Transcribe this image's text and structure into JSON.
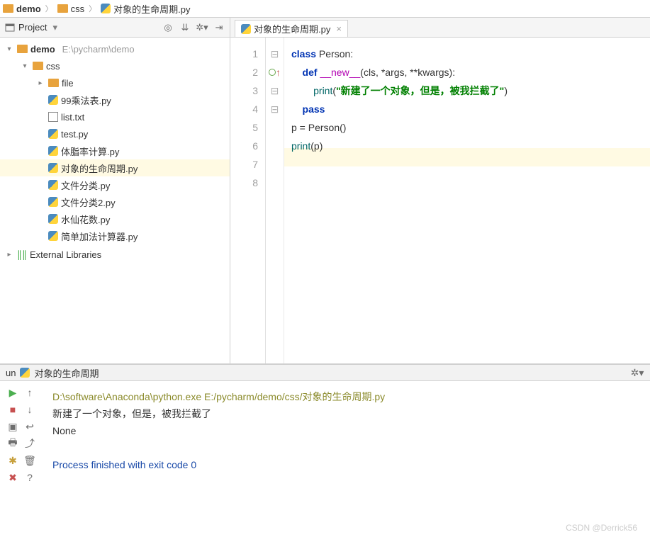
{
  "breadcrumbs": [
    {
      "icon": "folder",
      "label": "demo"
    },
    {
      "icon": "folder",
      "label": "css"
    },
    {
      "icon": "py",
      "label": "对象的生命周期.py"
    }
  ],
  "project": {
    "title": "Project",
    "view_mode": "▾",
    "root_label": "demo",
    "root_path": "E:\\pycharm\\demo",
    "folder": "css",
    "subfolder": "file",
    "files": [
      {
        "icon": "py",
        "name": "99乘法表.py",
        "sel": false
      },
      {
        "icon": "txt",
        "name": "list.txt",
        "sel": false
      },
      {
        "icon": "py",
        "name": "test.py",
        "sel": false
      },
      {
        "icon": "py",
        "name": "体脂率计算.py",
        "sel": false
      },
      {
        "icon": "py",
        "name": "对象的生命周期.py",
        "sel": true
      },
      {
        "icon": "py",
        "name": "文件分类.py",
        "sel": false
      },
      {
        "icon": "py",
        "name": "文件分类2.py",
        "sel": false
      },
      {
        "icon": "py",
        "name": "水仙花数.py",
        "sel": false
      },
      {
        "icon": "py",
        "name": "简单加法计算器.py",
        "sel": false
      }
    ],
    "external": "External Libraries"
  },
  "editor": {
    "tab": "对象的生命周期.py",
    "current_line": 7,
    "code": {
      "l1_pre": "class",
      "l1_cls": " Person:",
      "l2_def": "    def ",
      "l2_fn": "__new__",
      "l2_args": "(cls, *args, **kwargs):",
      "l3_print": "        print",
      "l3_open": "(",
      "l3_str": "\"新建了一个对象，但是，被我拦截了\"",
      "l3_close": ")",
      "l4": "    pass",
      "l5_lhs": "p = ",
      "l5_cls": "Person",
      "l5_paren": "()",
      "l6_print": "print",
      "l6_open": "(",
      "l6_arg": "p",
      "l6_close": ")"
    },
    "lines": [
      "1",
      "2",
      "3",
      "4",
      "5",
      "6",
      "7",
      "8"
    ]
  },
  "run": {
    "label": "un",
    "config": "对象的生命周期",
    "cmd": "D:\\software\\Anaconda\\python.exe E:/pycharm/demo/css/对象的生命周期.py",
    "out1": "新建了一个对象，但是，被我拦截了",
    "out2": "None",
    "exit": "Process finished with exit code 0"
  },
  "watermark": "CSDN @Derrick56"
}
